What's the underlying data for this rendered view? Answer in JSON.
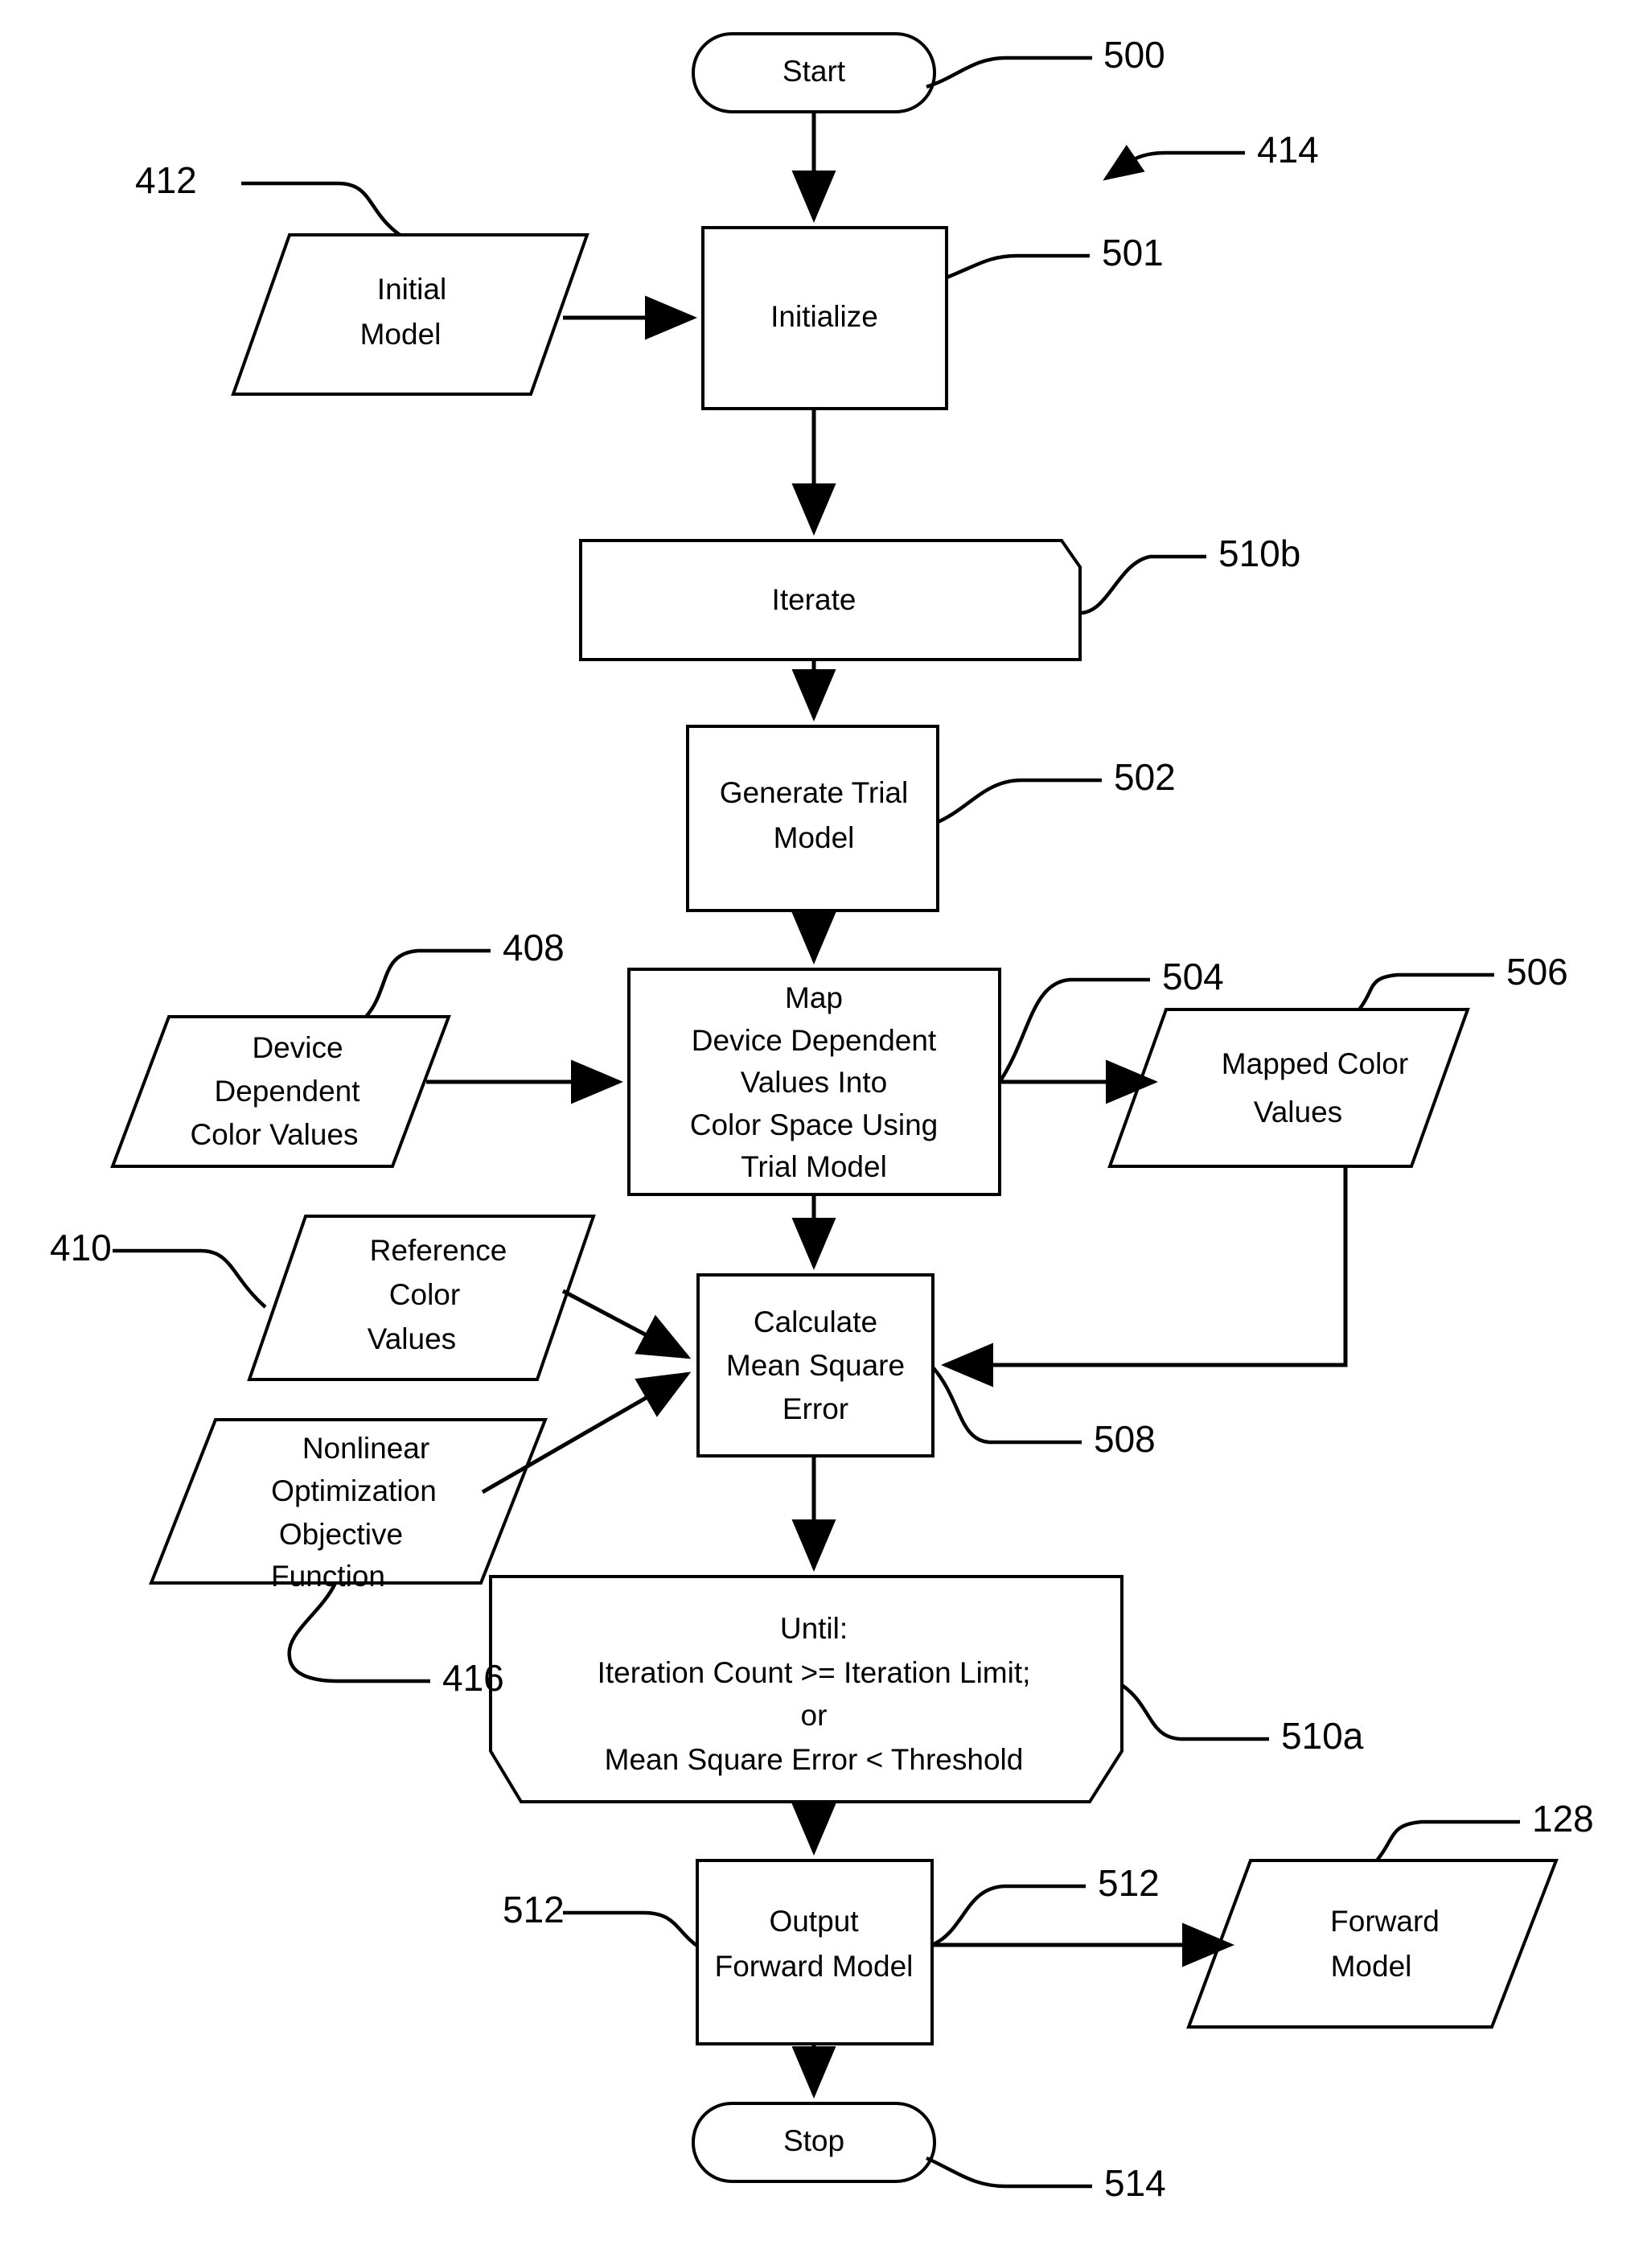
{
  "diagram": {
    "title": "Forward Model Generation Flowchart",
    "stroke_color": "#000000",
    "background_color": "#ffffff"
  },
  "nodes": {
    "start": {
      "label": "Start",
      "shape": "terminator"
    },
    "initial_model": {
      "label_1": "Initial",
      "label_2": "Model",
      "shape": "parallelogram"
    },
    "initialize": {
      "label": "Initialize",
      "shape": "process"
    },
    "iterate": {
      "label": "Iterate",
      "shape": "loop-start"
    },
    "generate_trial": {
      "label_1": "Generate Trial",
      "label_2": "Model",
      "shape": "process"
    },
    "device_values": {
      "label_1": "Device",
      "label_2": "Dependent",
      "label_3": "Color Values",
      "shape": "parallelogram"
    },
    "map": {
      "label_1": "Map",
      "label_2": "Device Dependent",
      "label_3": "Values Into",
      "label_4": "Color Space Using",
      "label_5": "Trial Model",
      "shape": "process"
    },
    "mapped_values": {
      "label_1": "Mapped Color",
      "label_2": "Values",
      "shape": "parallelogram"
    },
    "reference_values": {
      "label_1": "Reference",
      "label_2": "Color",
      "label_3": "Values",
      "shape": "parallelogram"
    },
    "nonlinear": {
      "label_1": "Nonlinear",
      "label_2": "Optimization",
      "label_3": "Objective",
      "label_4": "Function",
      "shape": "parallelogram"
    },
    "calculate_mse": {
      "label_1": "Calculate",
      "label_2": "Mean Square",
      "label_3": "Error",
      "shape": "process"
    },
    "until": {
      "label_1": "Until:",
      "label_2": "Iteration Count >= Iteration Limit;",
      "label_3": "or",
      "label_4": "Mean Square Error < Threshold",
      "shape": "loop-end"
    },
    "output_forward": {
      "label_1": "Output",
      "label_2": "Forward Model",
      "shape": "process"
    },
    "forward_model": {
      "label_1": "Forward",
      "label_2": "Model",
      "shape": "parallelogram"
    },
    "stop": {
      "label": "Stop",
      "shape": "terminator"
    }
  },
  "reference_numerals": {
    "n500": "500",
    "n414": "414",
    "n412": "412",
    "n501": "501",
    "n510b": "510b",
    "n502": "502",
    "n408": "408",
    "n504": "504",
    "n506": "506",
    "n410": "410",
    "n508": "508",
    "n416": "416",
    "n510a": "510a",
    "n512_left": "512",
    "n512_right": "512",
    "n128": "128",
    "n514": "514"
  }
}
